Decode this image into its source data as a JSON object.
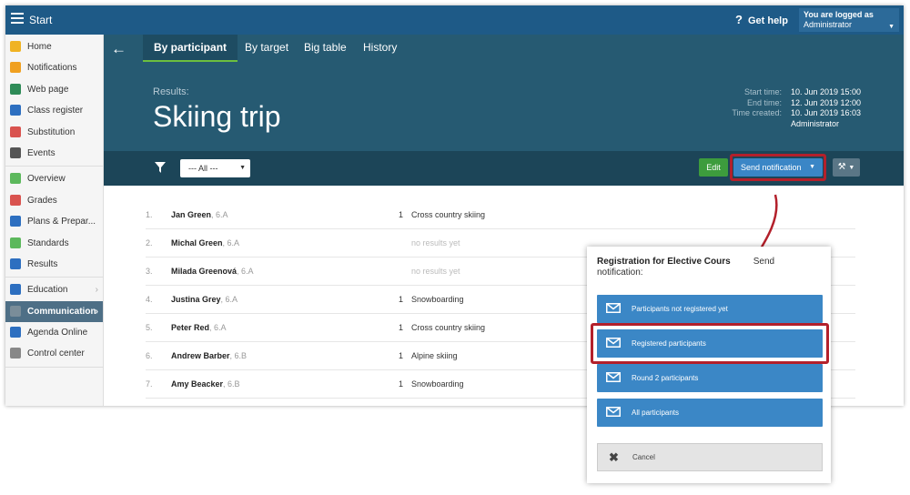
{
  "topbar": {
    "title": "Start",
    "help": "Get help",
    "user_label": "You are logged as",
    "user_name": "Administrator"
  },
  "sidebar": {
    "groups": [
      [
        {
          "label": "Home",
          "icon": "star-icon",
          "color": "#f0b323"
        },
        {
          "label": "Notifications",
          "icon": "envelope-icon",
          "color": "#f0a020"
        },
        {
          "label": "Web page",
          "icon": "house-icon",
          "color": "#2e8b57"
        },
        {
          "label": "Class register",
          "icon": "book-icon",
          "color": "#2d6fc0"
        },
        {
          "label": "Substitution",
          "icon": "person-icon",
          "color": "#d9534f"
        },
        {
          "label": "Events",
          "icon": "calendar-icon",
          "color": "#555555"
        }
      ],
      [
        {
          "label": "Overview",
          "icon": "check-circle-icon",
          "color": "#5cb85c"
        },
        {
          "label": "Grades",
          "icon": "grade-icon",
          "color": "#d9534f"
        },
        {
          "label": "Plans & Prepar...",
          "icon": "briefcase-icon",
          "color": "#2d6fc0"
        },
        {
          "label": "Standards",
          "icon": "shield-icon",
          "color": "#5cb85c"
        },
        {
          "label": "Results",
          "icon": "bar-chart-icon",
          "color": "#2d6fc0"
        }
      ],
      [
        {
          "label": "Education",
          "icon": "school-icon",
          "color": "#2d6fc0",
          "chevron": true
        },
        {
          "label": "Communication",
          "icon": "chat-icon",
          "color": "#7a8d99",
          "chevron": true,
          "active": true
        },
        {
          "label": "Agenda Online",
          "icon": "pen-icon",
          "color": "#2d6fc0"
        },
        {
          "label": "Control center",
          "icon": "gear-icon",
          "color": "#888888"
        }
      ]
    ]
  },
  "header": {
    "tabs": [
      "By participant",
      "By target",
      "Big table",
      "History"
    ],
    "active_tab": 0,
    "results_label": "Results:",
    "title": "Skiing trip",
    "meta": [
      {
        "k": "Start time:",
        "v": "10. Jun 2019 15:00"
      },
      {
        "k": "End time:",
        "v": "12. Jun 2019 12:00"
      },
      {
        "k": "Time created:",
        "v": "10. Jun 2019 16:03"
      },
      {
        "k": "",
        "v": "Administrator"
      }
    ]
  },
  "toolbar": {
    "filter_value": "--- All ---",
    "edit_label": "Edit",
    "send_label": "Send notification"
  },
  "participants": [
    {
      "num": "1.",
      "name": "Jan Green",
      "cls": ", 6.A",
      "rank": "1",
      "result": "Cross country skiing"
    },
    {
      "num": "2.",
      "name": "Michal Green",
      "cls": ", 6.A",
      "rank": "",
      "result": "no results yet"
    },
    {
      "num": "3.",
      "name": "Milada Greenová",
      "cls": ", 6.A",
      "rank": "",
      "result": "no results yet"
    },
    {
      "num": "4.",
      "name": "Justina Grey",
      "cls": ", 6.A",
      "rank": "1",
      "result": "Snowboarding"
    },
    {
      "num": "5.",
      "name": "Peter Red",
      "cls": ", 6.A",
      "rank": "1",
      "result": "Cross country skiing"
    },
    {
      "num": "6.",
      "name": "Andrew Barber",
      "cls": ", 6.B",
      "rank": "1",
      "result": "Alpine skiing"
    },
    {
      "num": "7.",
      "name": "Amy Beacker",
      "cls": ", 6.B",
      "rank": "1",
      "result": "Snowboarding"
    }
  ],
  "popup": {
    "title_bold": "Registration for Elective Cours",
    "title_rest": "Send notification:",
    "options": [
      "Participants not registered yet",
      "Registered participants",
      "Round 2 participants",
      "All participants"
    ],
    "cancel_label": "Cancel"
  },
  "colors": {
    "topbar": "#1e5a87",
    "header": "#265a72",
    "toolbar": "#1c4558",
    "accent": "#3a86c6",
    "highlight": "#b3202b",
    "edit": "#3d9c3d"
  }
}
